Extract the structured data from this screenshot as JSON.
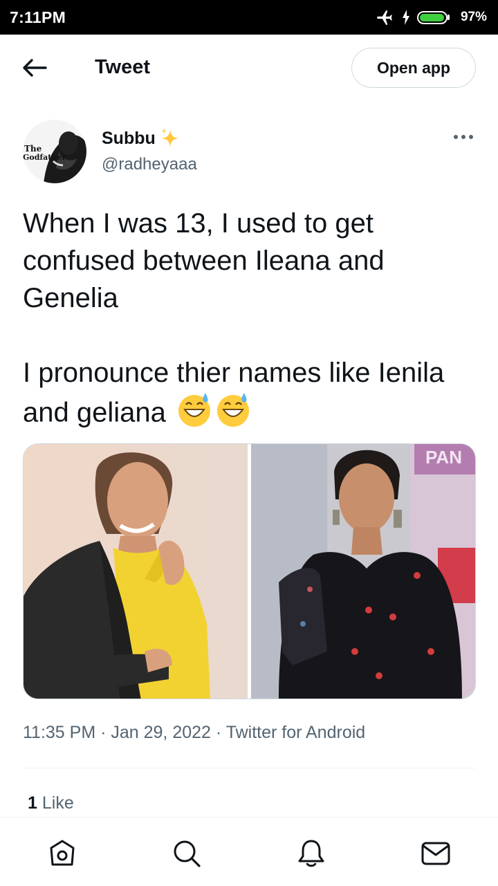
{
  "status_bar": {
    "time": "7:11PM",
    "battery_percent": "97%",
    "battery_level": 0.97,
    "icons": [
      "airplane-icon",
      "charging-bolt-icon",
      "battery-icon"
    ]
  },
  "top_nav": {
    "title": "Tweet",
    "back_icon": "arrow-left-icon",
    "open_app_label": "Open app"
  },
  "tweet": {
    "author": {
      "display_name": "Subbu",
      "name_emoji_icon": "sparkles-icon",
      "handle": "@radheyaaa",
      "avatar_text": "The Godfather"
    },
    "text": "When I was 13, I used to get confused between Ileana and Genelia\n\nI pronounce thier names like Ienila and geliana",
    "trailing_emoji": [
      "grinning-sweat-emoji",
      "grinning-sweat-emoji"
    ],
    "media": [
      {
        "description_icon": "photo-woman-yellow-blazer"
      },
      {
        "description_icon": "photo-woman-black-saree",
        "backdrop_text": "PAN"
      }
    ],
    "timestamp": "11:35 PM · Jan 29, 2022 · Twitter for Android",
    "likes_count": "1",
    "likes_label": "Like"
  },
  "bottom_nav": {
    "tabs": [
      "home-icon",
      "search-icon",
      "notifications-bell-icon",
      "messages-envelope-icon"
    ]
  },
  "colors": {
    "text_primary": "#0f1419",
    "text_secondary": "#536471",
    "border": "#cfd9de",
    "battery_green": "#3fcf3f",
    "status_bar_bg": "#000000"
  }
}
